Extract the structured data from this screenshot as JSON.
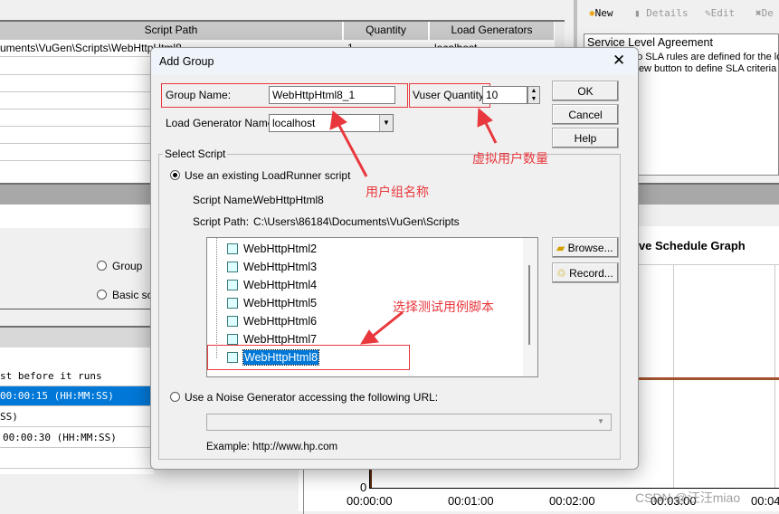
{
  "left_table": {
    "columns": [
      "Script Path",
      "Quantity",
      "Load Generators"
    ],
    "rows": [
      [
        "uments\\VuGen\\Scripts\\WebHttpHtml8",
        "1",
        "localhost"
      ]
    ]
  },
  "scheduler": {
    "radio_group": "Group",
    "radio_basic": "Basic sc",
    "actions": [
      "st before it runs",
      "00:00:15 (HH:MM:SS)",
      "SS)",
      "00:00:30 (HH:MM:SS)"
    ]
  },
  "sla": {
    "toolbar": [
      {
        "label": "New",
        "icon": "new-icon"
      },
      {
        "label": "Details",
        "icon": "details-icon"
      },
      {
        "label": "Edit",
        "icon": "edit-icon"
      },
      {
        "label": "De",
        "icon": "delete-icon"
      }
    ],
    "title": "Service Level Agreement",
    "line1": "no SLA rules are defined for the lo",
    "line2": "New button to define SLA criteria f"
  },
  "graph": {
    "title": "tive Schedule Graph",
    "y_tick": "0",
    "x_ticks": [
      "00:00:00",
      "00:01:00",
      "00:02:00",
      "00:03:00",
      "00:04"
    ],
    "line_color": "#a0522d"
  },
  "dialog": {
    "title": "Add Group",
    "group_name_label": "Group Name:",
    "group_name_value": "WebHttpHtml8_1",
    "vuser_label": "Vuser Quantity:",
    "vuser_value": "10",
    "lg_label": "Load Generator Name:",
    "lg_value": "localhost",
    "ok": "OK",
    "cancel": "Cancel",
    "help": "Help",
    "select_script": "Select Script",
    "use_existing": "Use an existing LoadRunner script",
    "script_name_label": "Script Name:",
    "script_name": "WebHttpHtml8",
    "script_path_label": "Script Path:",
    "script_path": "C:\\Users\\86184\\Documents\\VuGen\\Scripts",
    "scripts": [
      "WebHttpHtml2",
      "WebHttpHtml3",
      "WebHttpHtml4",
      "WebHttpHtml5",
      "WebHttpHtml6",
      "WebHttpHtml7",
      "WebHttpHtml8"
    ],
    "selected_script": "WebHttpHtml8",
    "browse": "Browse...",
    "record": "Record...",
    "use_noise": "Use a Noise Generator accessing the following URL:",
    "url_value": "",
    "example": "Example: http://www.hp.com"
  },
  "annotations": {
    "group_name": "用户组名称",
    "vuser": "虚拟用户数量",
    "script": "选择测试用例脚本"
  },
  "watermark": "CSDN @汪汪miao"
}
